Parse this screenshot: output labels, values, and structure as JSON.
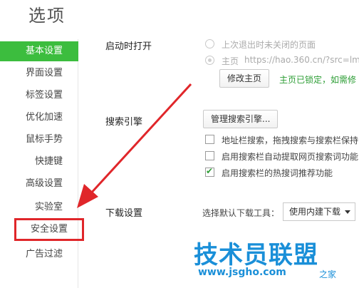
{
  "page": {
    "title": "选项"
  },
  "sidebar": {
    "items": [
      {
        "label": "基本设置",
        "active": true
      },
      {
        "label": "界面设置"
      },
      {
        "label": "标签设置"
      },
      {
        "label": "优化加速"
      },
      {
        "label": "鼠标手势"
      },
      {
        "label": "快捷键"
      },
      {
        "label": "高级设置"
      },
      {
        "label": "实验室"
      },
      {
        "label": "安全设置",
        "highlighted": true
      },
      {
        "label": "广告过滤"
      }
    ]
  },
  "startup": {
    "label": "启动时打开",
    "option_last": "上次退出时未关闭的页面",
    "option_home_prefix": "主页",
    "home_url": "https://hao.360.cn/?src=lm",
    "modify_button": "修改主页",
    "locked_note": "主页已锁定，如需修"
  },
  "search": {
    "label": "搜索引擎",
    "manage_button": "管理搜索引擎...",
    "options": [
      {
        "label": "地址栏搜索，拖拽搜索与搜索栏保持",
        "checked": false
      },
      {
        "label": "启用搜索栏自动提取网页搜索词功能",
        "checked": false
      },
      {
        "label": "启用搜索栏的热搜词推荐功能",
        "checked": true
      }
    ]
  },
  "download": {
    "label": "下载设置",
    "tool_label": "选择默认下载工具：",
    "selected": "使用内建下载"
  },
  "watermark": {
    "brand": "技术员联盟",
    "url": "www.jsgho.com",
    "suffix": "之家"
  },
  "colors": {
    "accent": "#3cbd3e",
    "highlight_box": "#e0262a",
    "watermark": "#1a8fd8"
  }
}
